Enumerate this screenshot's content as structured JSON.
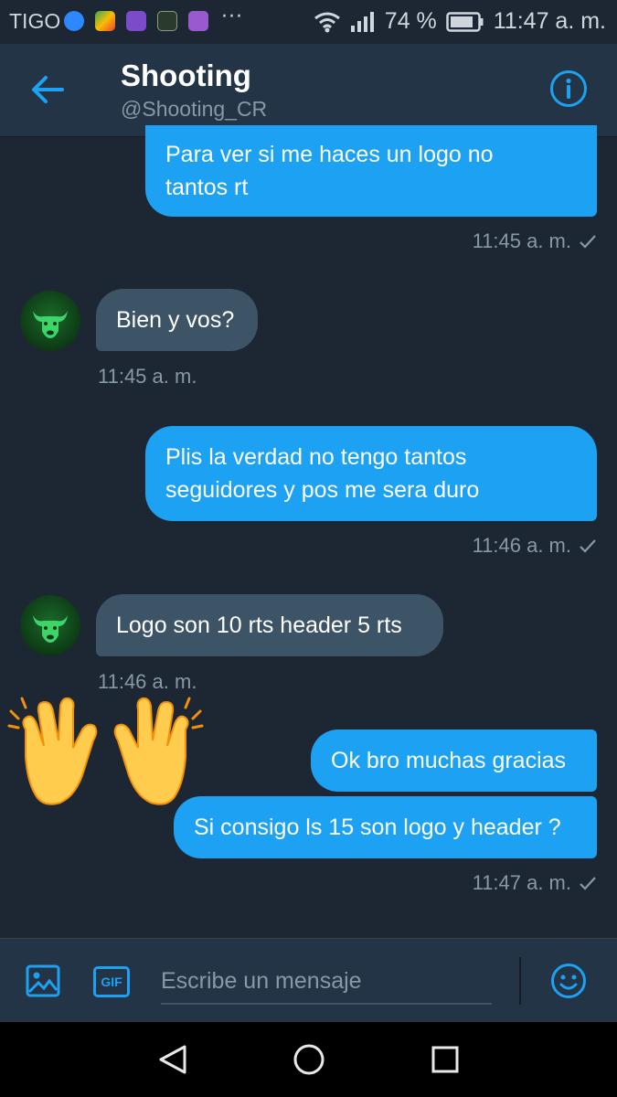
{
  "status_bar": {
    "carrier": "TIGO",
    "more": "···",
    "battery": "74 %",
    "time": "11:47 a. m."
  },
  "header": {
    "title": "Shooting",
    "handle": "@Shooting_CR"
  },
  "messages": [
    {
      "direction": "out",
      "text_lines": [
        "Para ver si me haces un logo no",
        "tantos rt"
      ],
      "time": "11:45 a. m.",
      "read": true
    },
    {
      "direction": "in",
      "text_lines": [
        "Bien y vos?"
      ],
      "time": "11:45 a. m."
    },
    {
      "direction": "out",
      "text_lines": [
        "Plis la verdad no tengo tantos",
        "seguidores y pos me sera duro"
      ],
      "time": "11:46 a. m.",
      "read": true
    },
    {
      "direction": "in",
      "text_lines": [
        "Logo son 10 rts header 5 rts"
      ],
      "time": "11:46 a. m."
    },
    {
      "direction": "out",
      "text_lines": [
        "Ok bro muchas gracias"
      ]
    },
    {
      "direction": "out",
      "text_lines": [
        "Si consigo ls 15 son logo y header ?"
      ],
      "time": "11:47 a. m.",
      "read": true
    }
  ],
  "sticker": "raised-hands-emoji",
  "composer": {
    "placeholder": "Escribe un mensaje",
    "gif_label": "GIF"
  },
  "colors": {
    "background": "#1c2733",
    "header": "#243447",
    "outgoing_bubble": "#1da1f2",
    "incoming_bubble": "#3d5466",
    "muted_text": "#8899a6",
    "accent": "#1da1f2"
  }
}
